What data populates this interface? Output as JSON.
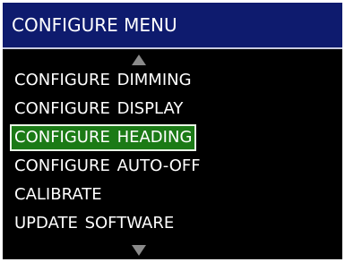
{
  "header": {
    "title": "CONFIGURE MENU"
  },
  "menu": {
    "scroll_up_icon": "triangle-up-icon",
    "scroll_down_icon": "triangle-down-icon",
    "items": [
      {
        "label": "CONFIGURE DIMMING",
        "selected": false
      },
      {
        "label": "CONFIGURE DISPLAY",
        "selected": false
      },
      {
        "label": "CONFIGURE HEADING",
        "selected": true
      },
      {
        "label": "CONFIGURE AUTO-OFF",
        "selected": false
      },
      {
        "label": "CALIBRATE",
        "selected": false
      },
      {
        "label": "UPDATE SOFTWARE",
        "selected": false
      }
    ]
  },
  "colors": {
    "screen_background": "#000000",
    "title_background": "#0e1b6e",
    "text": "#ffffff",
    "selection_background": "#1b7a16",
    "selection_border": "#e9f5e6",
    "arrow": "#8a8a8a"
  }
}
